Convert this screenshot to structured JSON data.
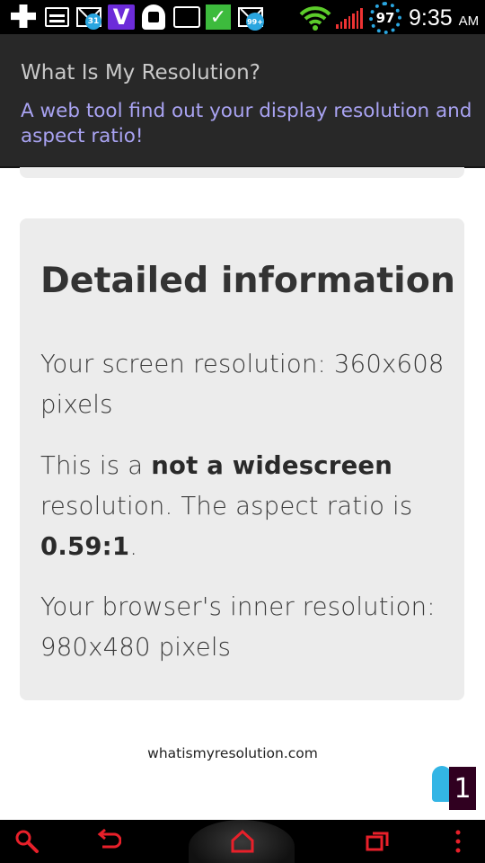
{
  "status_bar": {
    "time": "9:35",
    "ampm": "AM",
    "battery_level": "97",
    "calendar_badge": "31",
    "mail_badge": "99+",
    "accent_color": "#2aa6e0",
    "icons": [
      "add-icon",
      "card-icon",
      "calendar-mail-icon",
      "verizon-v-icon",
      "android-icon",
      "puzzle-icon",
      "check-icon",
      "gmail-icon",
      "wifi-icon",
      "signal-icon",
      "battery-icon"
    ]
  },
  "banner": {
    "title": "What Is My Resolution?",
    "subtitle": "A web tool find out your display resolution and aspect ratio!"
  },
  "card": {
    "title": "Detailed information",
    "screen_res": "Your screen resolution: 360x608 pixels",
    "widescreen_pre": "This is a ",
    "widescreen_bold": "not a widescreen",
    "widescreen_post": " resolution. The aspect ratio is ",
    "aspect_ratio": "0.59:1",
    "period": ".",
    "browser_res": "Your browser's inner resolution: 980x480 pixels"
  },
  "footer": {
    "site": "whatismyresolution.com"
  },
  "widget": {
    "counter": "1"
  },
  "nav": {
    "accent_color": "#e8202a",
    "icons": [
      "search-icon",
      "back-icon",
      "home-icon",
      "recent-apps-icon",
      "menu-icon"
    ]
  }
}
